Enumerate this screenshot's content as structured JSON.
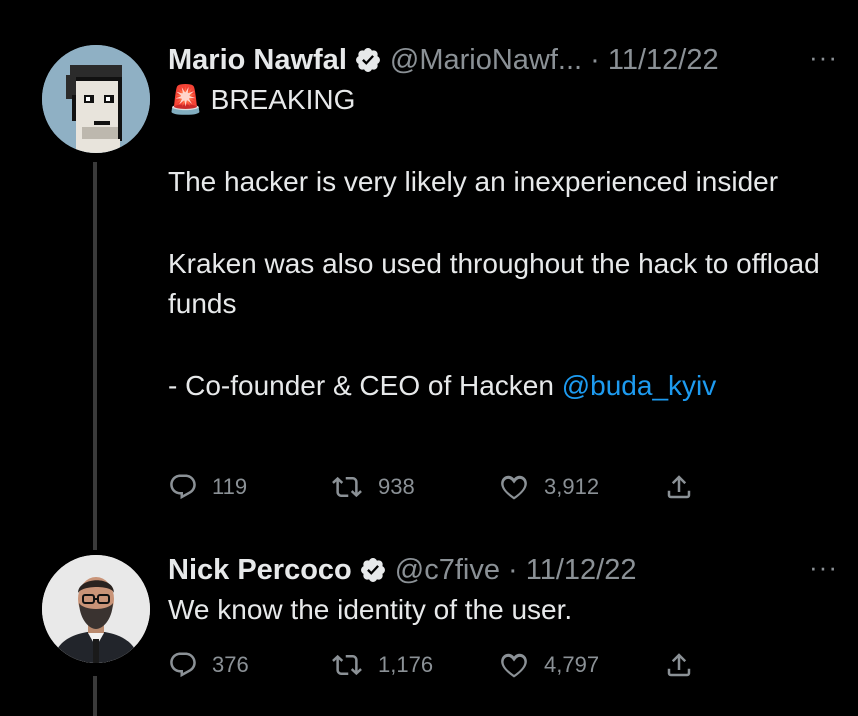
{
  "tweets": [
    {
      "name": "Mario Nawfal",
      "handle": "@MarioNawf...",
      "date": "11/12/22",
      "more": "···",
      "breaking_emoji": "🚨",
      "breaking_label": "BREAKING",
      "para1": "The hacker is very likely an inexperienced insider",
      "para2": "Kraken was also used throughout the hack to offload funds",
      "para3_prefix": "- Co-founder & CEO of Hacken ",
      "mention": "@buda_kyiv",
      "replies": "119",
      "retweets": "938",
      "likes": "3,912"
    },
    {
      "name": "Nick Percoco",
      "handle": "@c7five",
      "date": "11/12/22",
      "more": "···",
      "text": "We know the identity of the user.",
      "replies": "376",
      "retweets": "1,176",
      "likes": "4,797"
    }
  ],
  "icons": {
    "verified": "verified-badge-icon",
    "reply": "reply-icon",
    "retweet": "retweet-icon",
    "like": "heart-icon",
    "share": "share-icon"
  },
  "colors": {
    "background": "#000000",
    "text": "#e7e9ea",
    "muted": "#8b9196",
    "link": "#1d9bf0",
    "thread_line": "#3a3a3a"
  }
}
